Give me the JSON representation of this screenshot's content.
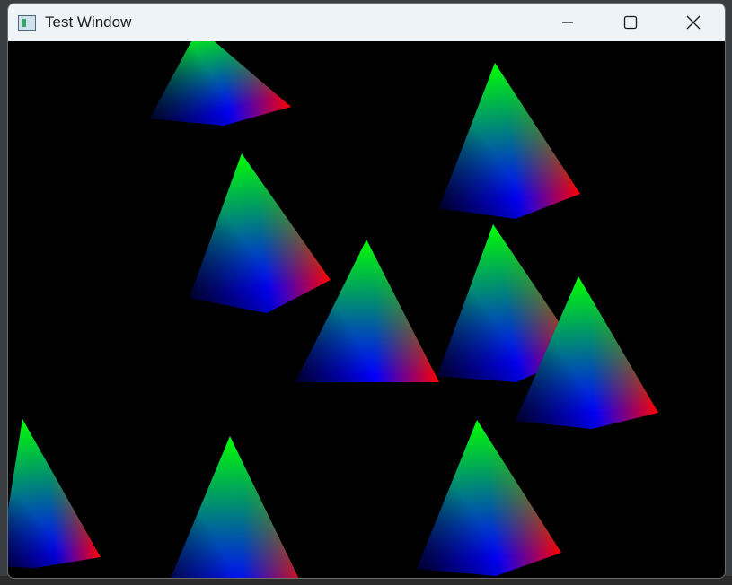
{
  "window": {
    "title": "Test Window",
    "app_icon": "window-app-icon",
    "controls": [
      {
        "name": "minimize-button",
        "icon": "minimize-icon"
      },
      {
        "name": "maximize-button",
        "icon": "maximize-icon"
      },
      {
        "name": "close-button",
        "icon": "close-icon"
      }
    ]
  },
  "scene": {
    "background": "#000000",
    "vertex_colors": {
      "apex": "#00ff00",
      "base_left": "#0000ff",
      "base_right": "#ff0000"
    },
    "pyramid_count": 9
  }
}
